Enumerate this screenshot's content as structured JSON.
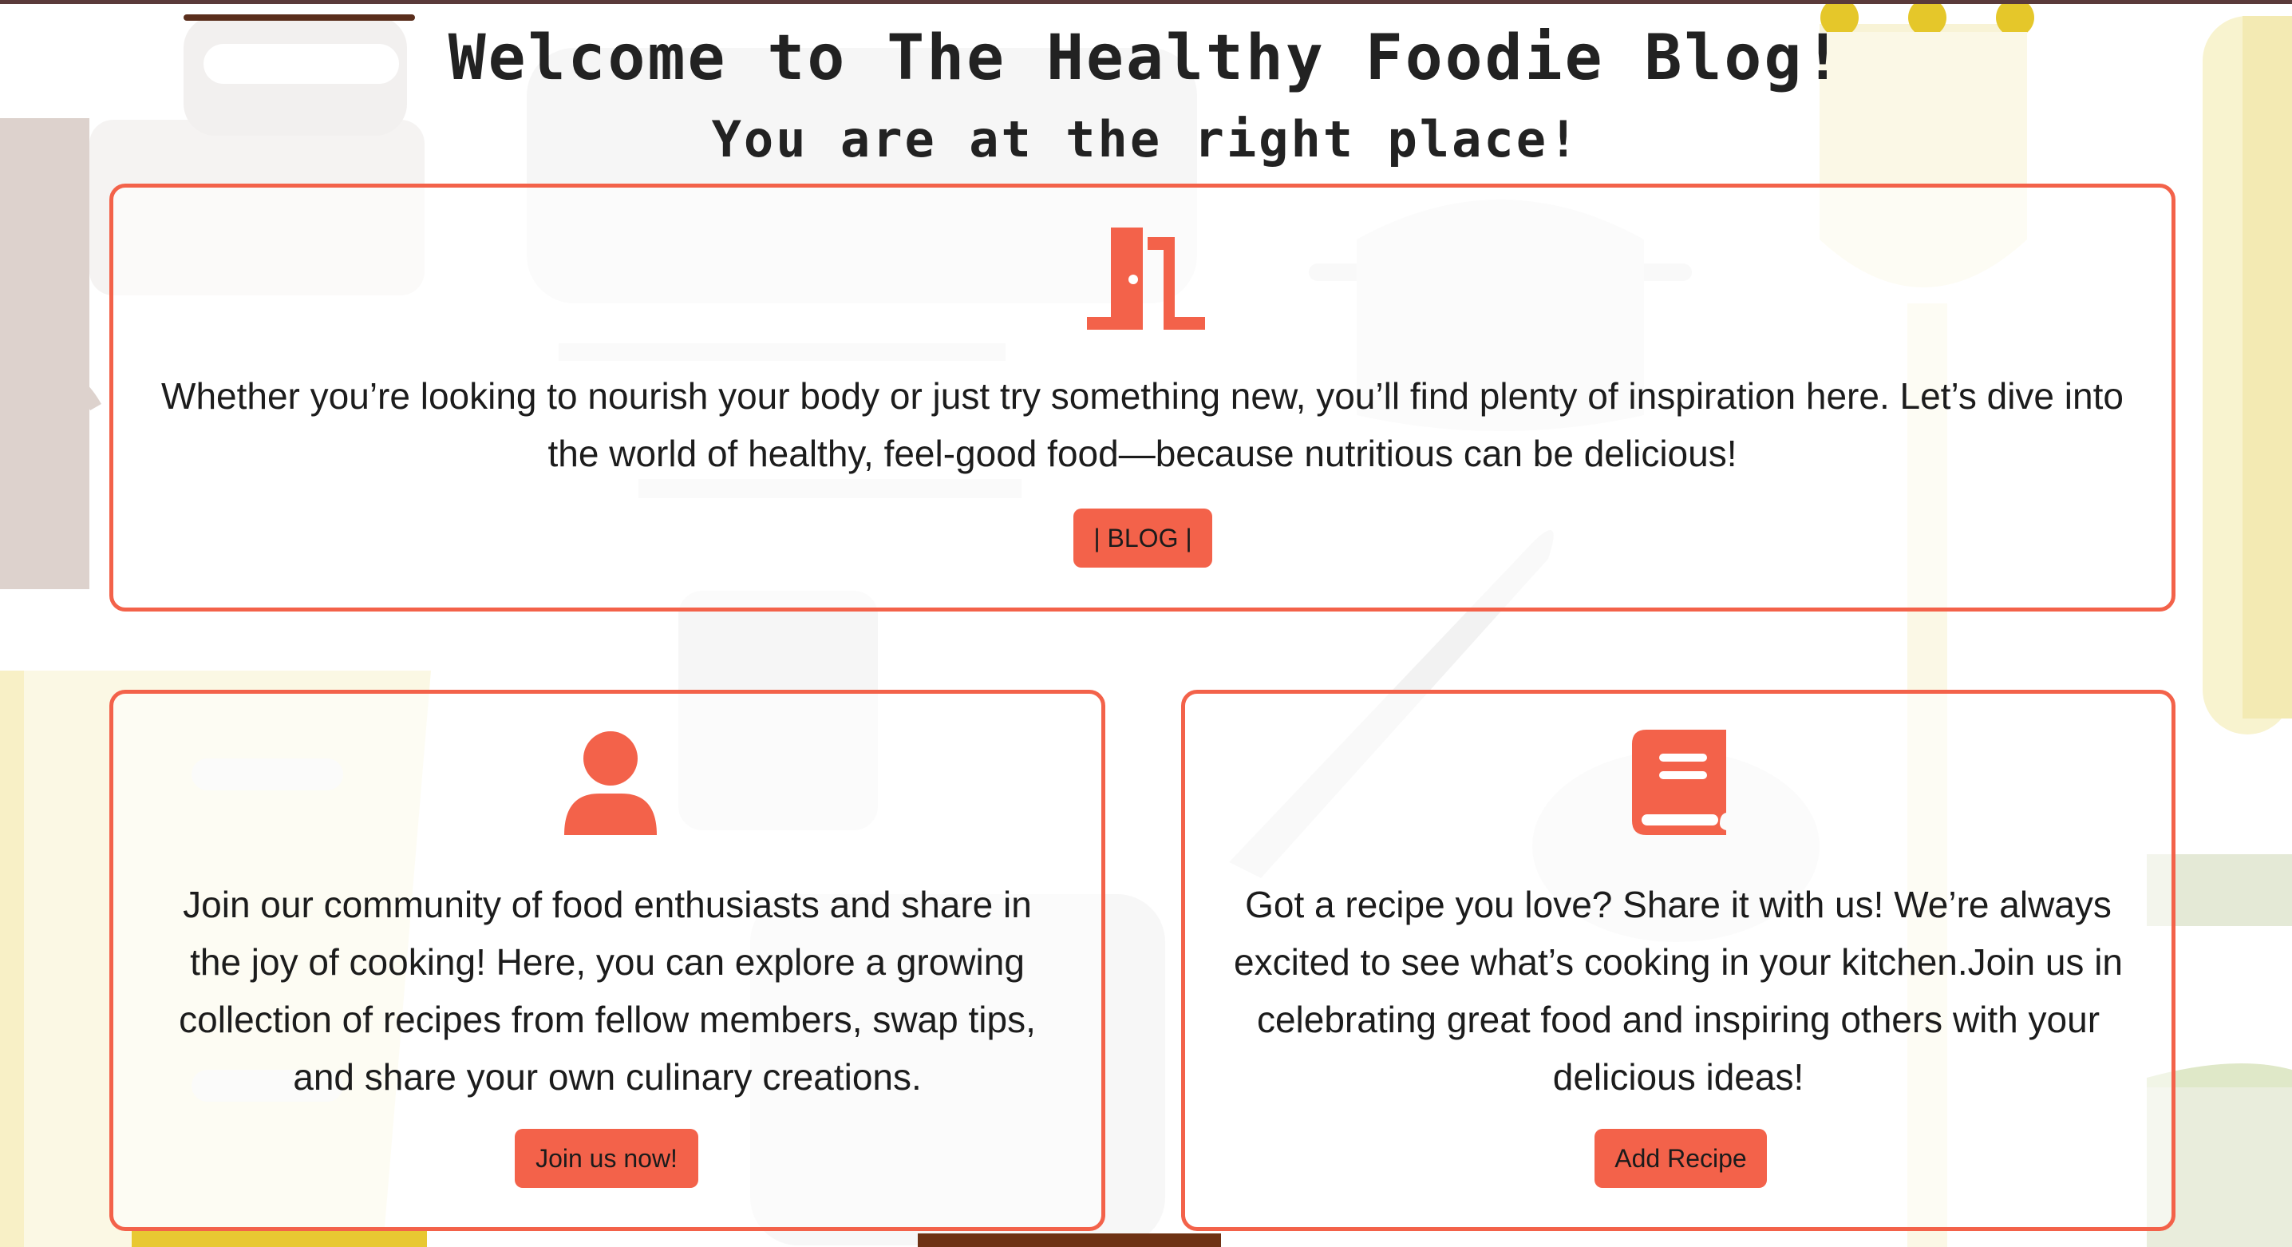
{
  "header": {
    "title": "Welcome to The Healthy Foodie Blog!",
    "subtitle": "You are at the right place!"
  },
  "colors": {
    "accent": "#f3624a",
    "text": "#1c1c1c",
    "background": "#ffffff"
  },
  "blog_card": {
    "icon": "door-open-icon",
    "text": "Whether you’re looking to nourish your body or just try something new, you’ll find plenty of inspiration here. Let’s dive into the world of healthy, feel-good food—because nutritious can be delicious!",
    "button_label": "| BLOG |"
  },
  "community_card": {
    "icon": "user-icon",
    "text": "Join our community of food enthusiasts and share in the joy of cooking! Here, you can explore a growing collection of recipes from fellow members, swap tips, and share your own culinary creations.",
    "button_label": "Join us now!"
  },
  "recipe_card": {
    "icon": "book-icon",
    "text": "Got a recipe you love? Share it with us! We’re always excited to see what’s cooking in your kitchen.Join us in celebrating great food and inspiring others with your delicious ideas!",
    "button_label": "Add Recipe"
  }
}
